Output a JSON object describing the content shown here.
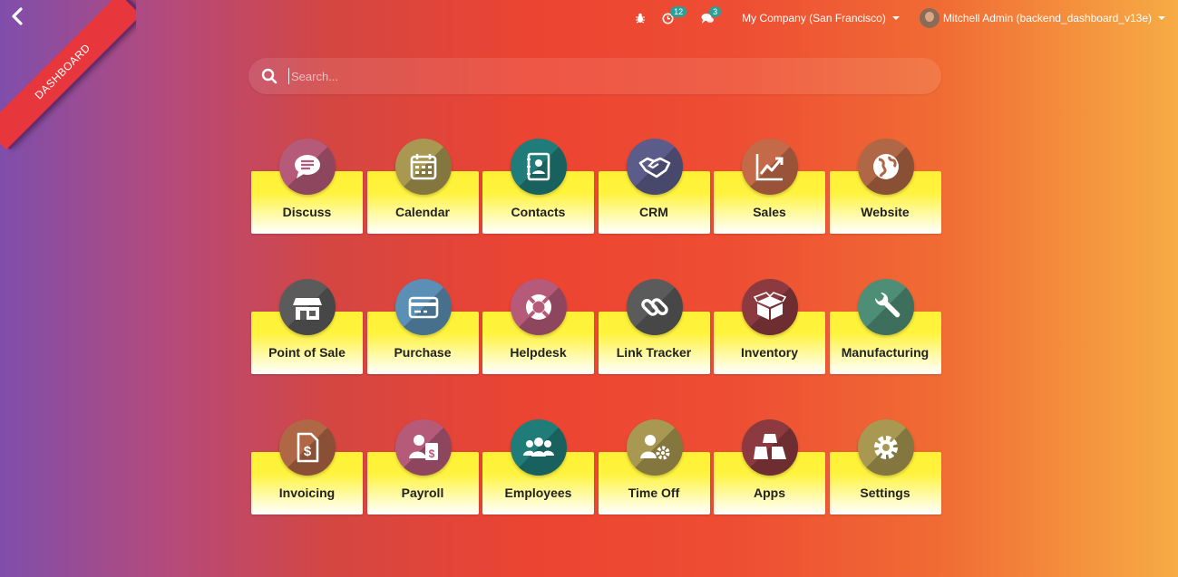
{
  "ribbon": {
    "text": "DASHBOARD"
  },
  "topbar": {
    "activity_count": "12",
    "messages_count": "3",
    "company": "My Company (San Francisco)",
    "user": "Mitchell Admin (backend_dashboard_v13e)"
  },
  "search": {
    "placeholder": "Search..."
  },
  "apps": [
    [
      {
        "label": "Discuss",
        "color": "#b65a79",
        "icon": "chat-icon"
      },
      {
        "label": "Calendar",
        "color": "#a89851",
        "icon": "calendar-icon"
      },
      {
        "label": "Contacts",
        "color": "#1f7c79",
        "icon": "address-book-icon"
      },
      {
        "label": "CRM",
        "color": "#5c5c8a",
        "icon": "handshake-icon"
      },
      {
        "label": "Sales",
        "color": "#c46a48",
        "icon": "chart-line-icon"
      },
      {
        "label": "Website",
        "color": "#b06745",
        "icon": "globe-icon"
      }
    ],
    [
      {
        "label": "Point of Sale",
        "color": "#5b5b5b",
        "icon": "store-icon"
      },
      {
        "label": "Purchase",
        "color": "#5b8fb5",
        "icon": "credit-card-icon"
      },
      {
        "label": "Helpdesk",
        "color": "#b65a79",
        "icon": "lifebuoy-icon"
      },
      {
        "label": "Link Tracker",
        "color": "#5b5b5b",
        "icon": "link-icon"
      },
      {
        "label": "Inventory",
        "color": "#8c3a3f",
        "icon": "box-icon"
      },
      {
        "label": "Manufacturing",
        "color": "#4f8e76",
        "icon": "wrench-icon"
      }
    ],
    [
      {
        "label": "Invoicing",
        "color": "#b06745",
        "icon": "invoice-icon"
      },
      {
        "label": "Payroll",
        "color": "#b65a79",
        "icon": "payroll-icon"
      },
      {
        "label": "Employees",
        "color": "#1f7c79",
        "icon": "users-icon"
      },
      {
        "label": "Time Off",
        "color": "#a89851",
        "icon": "user-gear-icon"
      },
      {
        "label": "Apps",
        "color": "#8c3a3f",
        "icon": "cubes-icon"
      },
      {
        "label": "Settings",
        "color": "#a89851",
        "icon": "gear-icon"
      }
    ]
  ]
}
